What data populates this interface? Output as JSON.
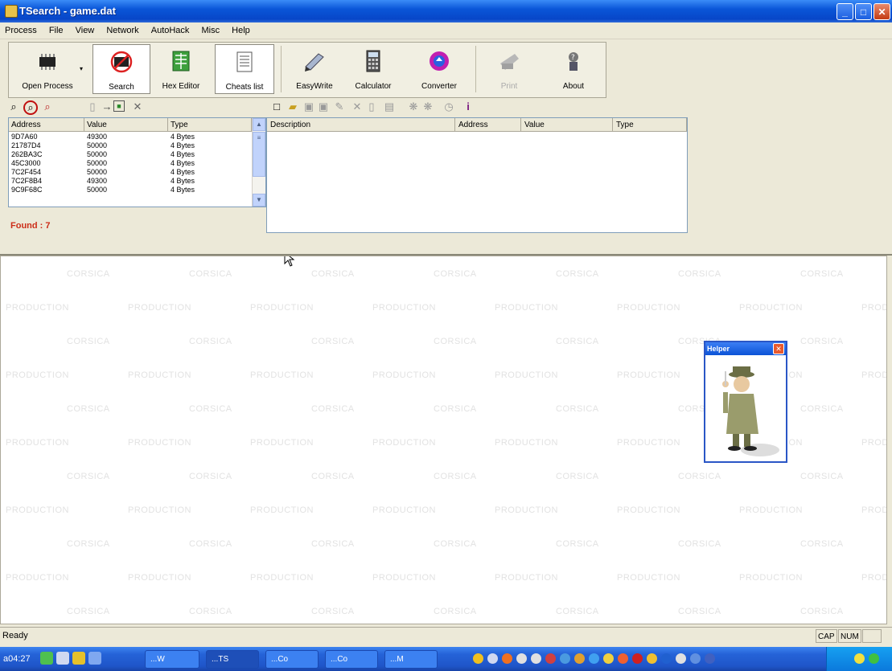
{
  "window": {
    "title": "TSearch - game.dat"
  },
  "menu": [
    "Process",
    "File",
    "View",
    "Network",
    "AutoHack",
    "Misc",
    "Help"
  ],
  "toolbar": {
    "buttons": [
      {
        "label": "Open Process",
        "icon": "chip-icon"
      },
      {
        "label": "Search",
        "icon": "search-chip-icon"
      },
      {
        "label": "Hex Editor",
        "icon": "hex-editor-icon"
      },
      {
        "label": "Cheats list",
        "icon": "cheat-list-icon"
      },
      {
        "label": "EasyWrite",
        "icon": "easywrite-icon"
      },
      {
        "label": "Calculator",
        "icon": "calculator-icon"
      },
      {
        "label": "Converter",
        "icon": "converter-icon"
      },
      {
        "label": "Print",
        "icon": "print-icon"
      },
      {
        "label": "About",
        "icon": "about-icon"
      }
    ]
  },
  "search_results": {
    "columns": [
      "Address",
      "Value",
      "Type"
    ],
    "rows": [
      [
        "9D7A60",
        "49300",
        "4 Bytes"
      ],
      [
        "21787D4",
        "50000",
        "4 Bytes"
      ],
      [
        "262BA3C",
        "50000",
        "4 Bytes"
      ],
      [
        "45C3000",
        "50000",
        "4 Bytes"
      ],
      [
        "7C2F454",
        "50000",
        "4 Bytes"
      ],
      [
        "7C2F8B4",
        "49300",
        "4 Bytes"
      ],
      [
        "9C9F68C",
        "50000",
        "4 Bytes"
      ]
    ],
    "found_label": "Found : 7"
  },
  "cheat_list": {
    "columns": [
      "Description",
      "Address",
      "Value",
      "Type"
    ]
  },
  "watermark": {
    "line1": "CORSICA",
    "line2": "PRODUCTION"
  },
  "helper": {
    "title": "Helper"
  },
  "status": {
    "text": "Ready",
    "cap": "CAP",
    "num": "NUM"
  },
  "taskbar": {
    "start_text": "a04:27",
    "tasks": [
      "...W",
      "...TS",
      "...Co",
      "...Co",
      "...M"
    ]
  },
  "colors": {
    "accent": "#0a56d8",
    "found": "#cc2d18"
  }
}
